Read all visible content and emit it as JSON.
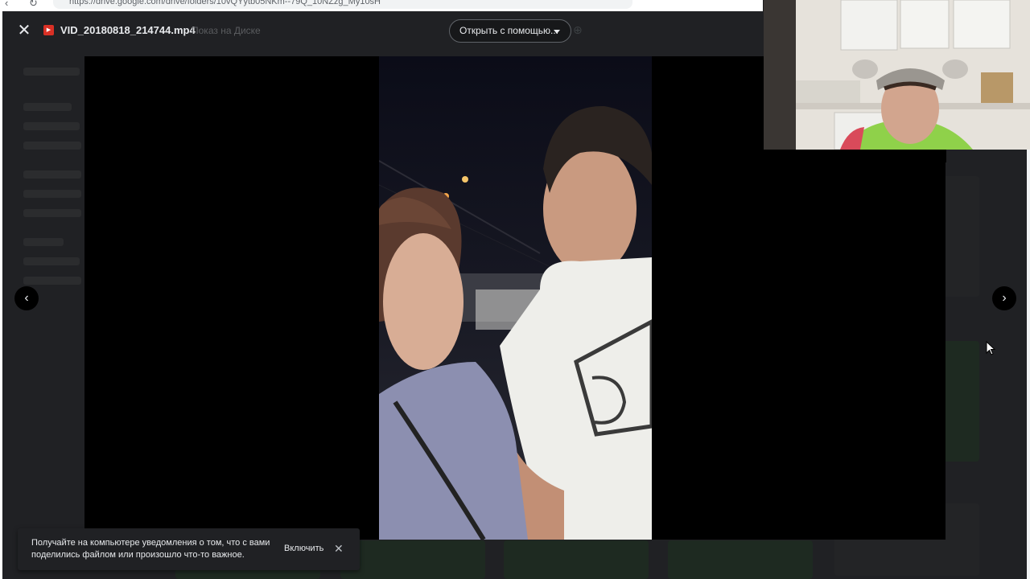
{
  "browser": {
    "url": "https://drive.google.com/drive/folders/10vQYytb05NKm--79Q_10NZzg_My10sH"
  },
  "viewer": {
    "file_name": "VID_20180818_214744.mp4",
    "file_location": "Показ на Диске",
    "open_with_label": "Открыть с помощью...",
    "close_icon": "close-icon",
    "prev_icon": "chevron-left-icon",
    "next_icon": "chevron-right-icon",
    "file_type_icon": "video-file-icon"
  },
  "notification": {
    "message": "Получайте на компьютере уведомления о том, что с вами поделились файлом или произошло что-то важное.",
    "action_label": "Включить"
  },
  "colors": {
    "accent_file_icon": "#d93025",
    "overlay_bg": "#202124",
    "text_primary": "#e8eaed"
  }
}
